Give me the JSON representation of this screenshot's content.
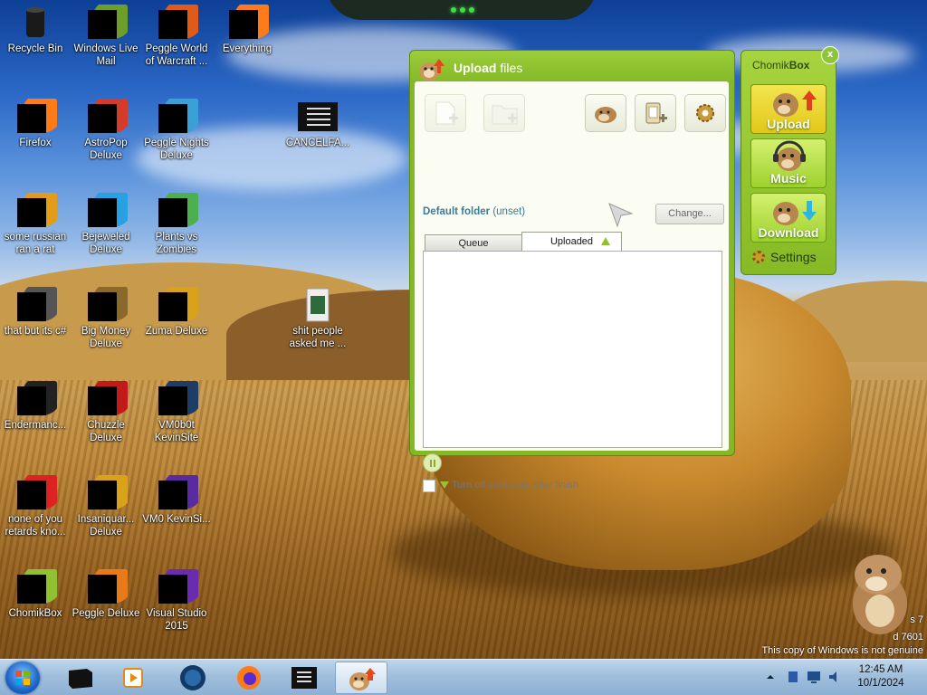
{
  "desktop": {
    "icons": [
      {
        "name": "recycle-bin-icon",
        "label": "Recycle Bin"
      },
      {
        "name": "windows-live-mail-icon",
        "label": "Windows Live Mail"
      },
      {
        "name": "peggle-wow-icon",
        "label": "Peggle World of Warcraft ..."
      },
      {
        "name": "everything-icon",
        "label": "Everything"
      },
      {
        "name": "firefox-icon",
        "label": "Firefox"
      },
      {
        "name": "astropop-icon",
        "label": "AstroPop Deluxe"
      },
      {
        "name": "peggle-nights-icon",
        "label": "Peggle Nights Deluxe"
      },
      {
        "name": "cancelfa-icon",
        "label": "CANCELFA..."
      },
      {
        "name": "russian-rat-icon",
        "label": "some russian ran a rat"
      },
      {
        "name": "bejeweled-icon",
        "label": "Bejeweled Deluxe"
      },
      {
        "name": "plants-vs-zombies-icon",
        "label": "Plants vs Zombies"
      },
      {
        "name": "csharp-icon",
        "label": "that but its c#"
      },
      {
        "name": "big-money-icon",
        "label": "Big Money Deluxe"
      },
      {
        "name": "zuma-icon",
        "label": "Zuma Deluxe"
      },
      {
        "name": "shit-people-folder-icon",
        "label": "shit people asked me ..."
      },
      {
        "name": "endermanc-icon",
        "label": "Endermanc..."
      },
      {
        "name": "chuzzle-icon",
        "label": "Chuzzle Deluxe"
      },
      {
        "name": "vm0b0t-icon",
        "label": "VM0b0t KevinSite"
      },
      {
        "name": "retards-icon",
        "label": "none of you retards kno..."
      },
      {
        "name": "insaniquarium-icon",
        "label": "Insaniquar... Deluxe"
      },
      {
        "name": "vm0-kevinsi-icon",
        "label": "VM0 KevinSi..."
      },
      {
        "name": "chomikbox-desktop-icon",
        "label": "ChomikBox"
      },
      {
        "name": "peggle-deluxe-icon",
        "label": "Peggle Deluxe"
      },
      {
        "name": "visual-studio-icon",
        "label": "Visual Studio 2015"
      }
    ]
  },
  "upload_window": {
    "title_bold": "Upload",
    "title_rest": " files",
    "default_folder_label": "Default folder",
    "default_folder_value": " (unset)",
    "change_button": "Change...",
    "tabs": [
      {
        "label": "Queue"
      },
      {
        "label": "Uploaded"
      }
    ],
    "turn_off_label": "Turn off computer after finish"
  },
  "side_panel": {
    "title_plain": "Chomik",
    "title_bold": "Box",
    "close": "x",
    "buttons": [
      {
        "label": "Upload",
        "active": true
      },
      {
        "label": "Music",
        "active": false
      },
      {
        "label": "Download",
        "active": false
      }
    ],
    "settings_label": "Settings"
  },
  "watermark": {
    "line1": "s 7",
    "line2": "d 7601",
    "line3": "This copy of Windows is not genuine"
  },
  "taskbar": {
    "time": "12:45 AM",
    "date": "10/1/2024"
  },
  "colors": {
    "accent_green": "#84b826",
    "active_yellow": "#e3c71a"
  }
}
